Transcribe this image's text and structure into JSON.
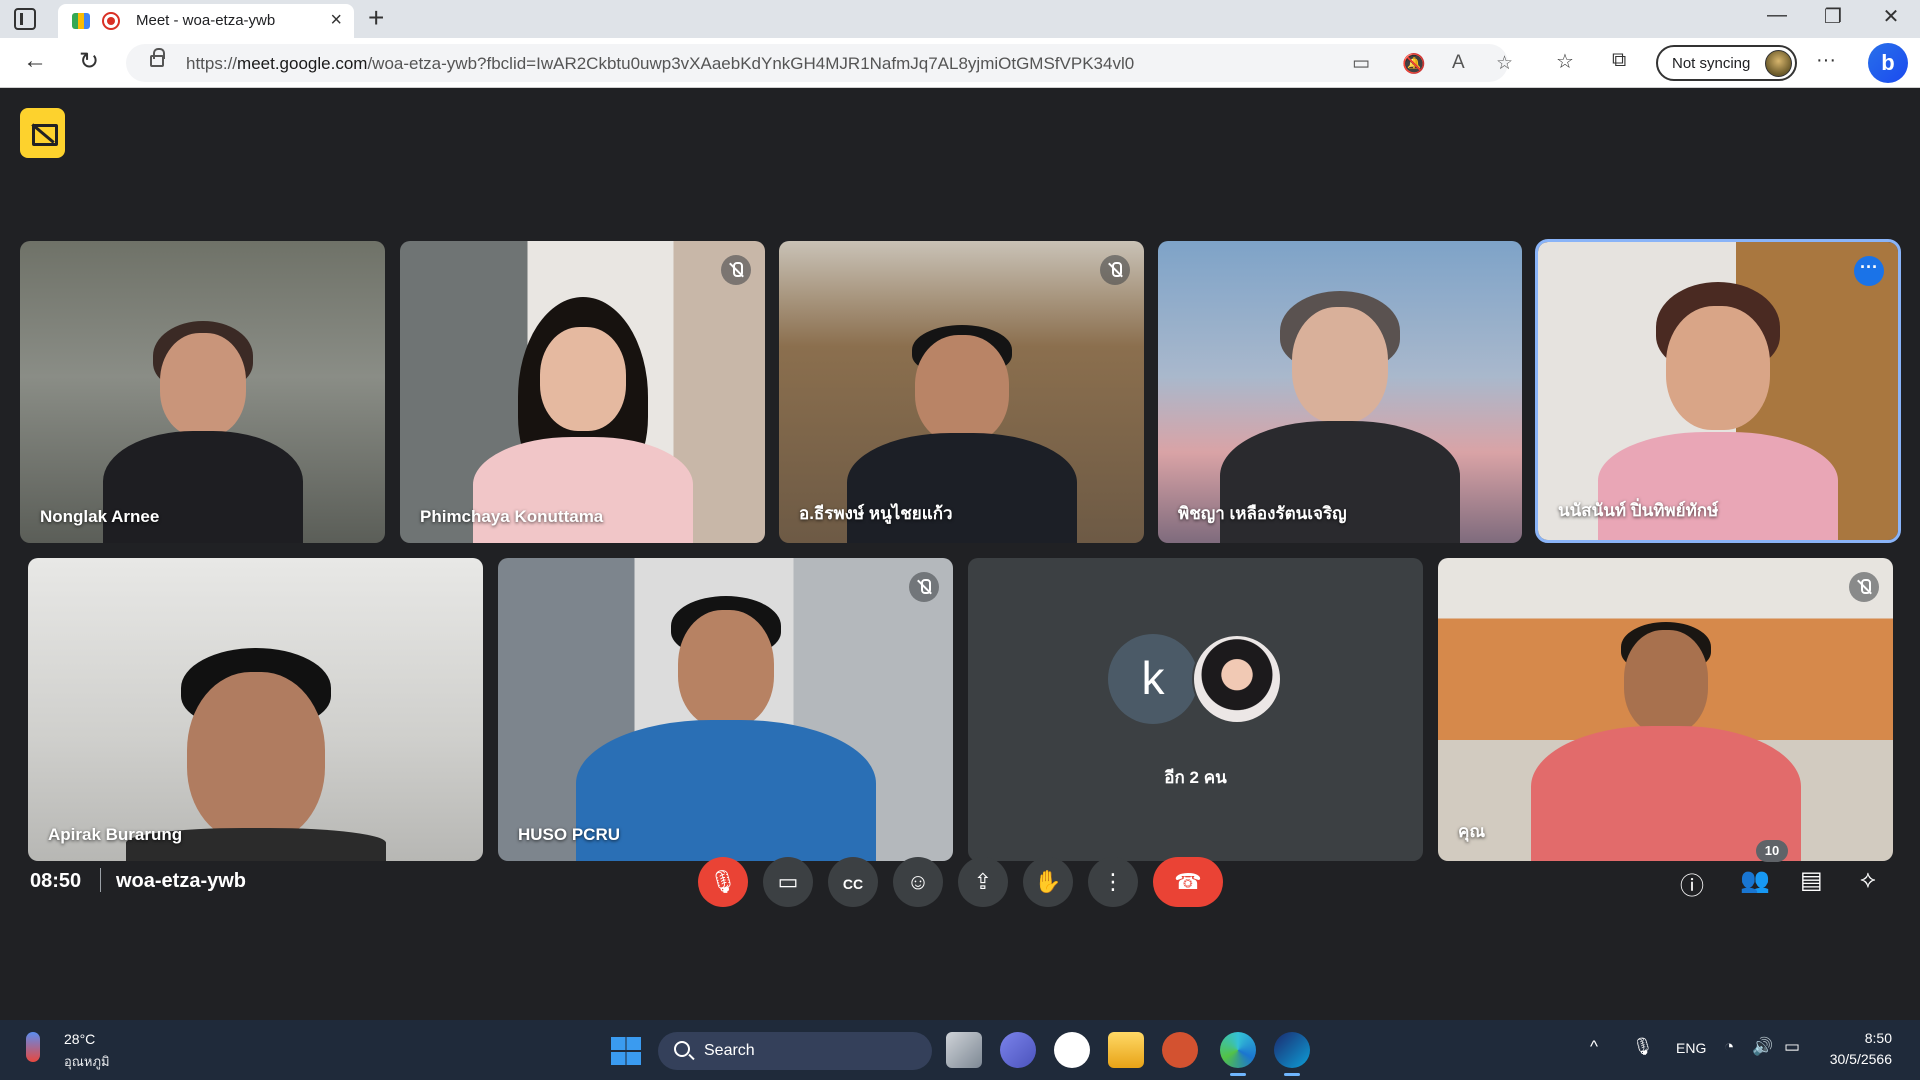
{
  "browser": {
    "tab_title": "Meet - woa-etza-ywb",
    "url_scheme": "https://",
    "url_host": "meet.google.com",
    "url_path": "/woa-etza-ywb?fbclid=IwAR2Ckbtu0uwp3vXAaebKdYnkGH4MJR1NafmJq7AL8yjmiOtGMSfVPK34vl0",
    "sync_label": "Not syncing"
  },
  "participants": [
    {
      "name": "Nonglak Arnee",
      "muted": false
    },
    {
      "name": "Phimchaya Konuttama",
      "muted": true
    },
    {
      "name": "อ.ธีรพงษ์ หนูไชยแก้ว",
      "muted": true
    },
    {
      "name": "พิชญา เหลืองรัตนเจริญ",
      "muted": false
    },
    {
      "name": "นนัสนันท์ ปิ่นทิพย์ทักษ์",
      "muted": false,
      "active": true
    },
    {
      "name": "Apirak Burarung",
      "muted": false
    },
    {
      "name": "HUSO PCRU",
      "muted": true
    },
    {
      "name": "คุณ",
      "muted": true
    }
  ],
  "others_tile": {
    "initial": "k",
    "label": "อีก 2 คน"
  },
  "meeting": {
    "time": "08:50",
    "code": "woa-etza-ywb",
    "participant_count": "10"
  },
  "colors": {
    "accent": "#1a73e8",
    "hangup": "#ea4335",
    "present_badge": "#fdd22d",
    "bg": "#202124"
  },
  "taskbar": {
    "temperature": "28°C",
    "weather_desc": "อุณหภูมิ",
    "search": "Search",
    "lang": "ENG",
    "time": "8:50",
    "date": "30/5/2566"
  }
}
